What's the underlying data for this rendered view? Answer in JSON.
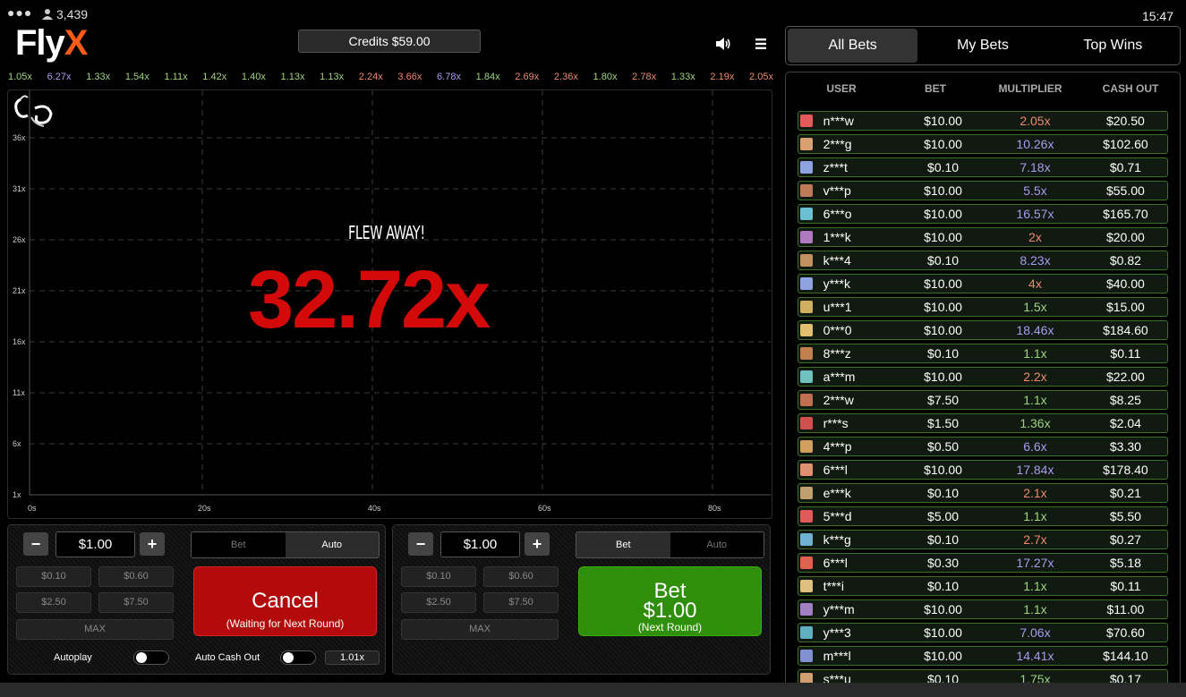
{
  "header": {
    "players_count": "3,439",
    "logo_fly": "Fly",
    "logo_x": "X",
    "credits": "Credits $59.00",
    "time": "15:47"
  },
  "history": [
    {
      "v": "1.05x",
      "c": "#9fd47f"
    },
    {
      "v": "6.27x",
      "c": "#a89cf0"
    },
    {
      "v": "1.33x",
      "c": "#9fd47f"
    },
    {
      "v": "1.54x",
      "c": "#9fd47f"
    },
    {
      "v": "1.11x",
      "c": "#9fd47f"
    },
    {
      "v": "1.42x",
      "c": "#9fd47f"
    },
    {
      "v": "1.40x",
      "c": "#9fd47f"
    },
    {
      "v": "1.13x",
      "c": "#9fd47f"
    },
    {
      "v": "1.13x",
      "c": "#9fd47f"
    },
    {
      "v": "2.24x",
      "c": "#f08a6a"
    },
    {
      "v": "3.66x",
      "c": "#f08a6a"
    },
    {
      "v": "6.78x",
      "c": "#a89cf0"
    },
    {
      "v": "1.84x",
      "c": "#9fd47f"
    },
    {
      "v": "2.69x",
      "c": "#f08a6a"
    },
    {
      "v": "2.36x",
      "c": "#f08a6a"
    },
    {
      "v": "1.80x",
      "c": "#9fd47f"
    },
    {
      "v": "2.78x",
      "c": "#f08a6a"
    },
    {
      "v": "1.33x",
      "c": "#9fd47f"
    },
    {
      "v": "2.19x",
      "c": "#f08a6a"
    },
    {
      "v": "2.05x",
      "c": "#f08a6a"
    }
  ],
  "game": {
    "status": "FLEW AWAY!",
    "crash_multiplier": "32.72x",
    "y_ticks": [
      "36x",
      "31x",
      "26x",
      "21x",
      "16x",
      "11x",
      "6x",
      "1x"
    ],
    "x_ticks": [
      "0s",
      "20s",
      "40s",
      "60s",
      "80s"
    ]
  },
  "panel1": {
    "minus": "−",
    "plus": "+",
    "amount": "$1.00",
    "chips": [
      "$0.10",
      "$0.60",
      "$2.50",
      "$7.50"
    ],
    "max": "MAX",
    "mode_bet": "Bet",
    "mode_auto": "Auto",
    "active_mode": "Auto",
    "button_main": "Cancel",
    "button_sub": "(Waiting for Next Round)",
    "autoplay_label": "Autoplay",
    "autocashout_label": "Auto Cash Out",
    "autocashout_value": "1.01x"
  },
  "panel2": {
    "minus": "−",
    "plus": "+",
    "amount": "$1.00",
    "chips": [
      "$0.10",
      "$0.60",
      "$2.50",
      "$7.50"
    ],
    "max": "MAX",
    "mode_bet": "Bet",
    "mode_auto": "Auto",
    "active_mode": "Bet",
    "button_main": "Bet",
    "button_amount": "$1.00",
    "button_sub": "(Next Round)"
  },
  "tabs": [
    "All Bets",
    "My Bets",
    "Top Wins"
  ],
  "bets": {
    "columns": [
      "USER",
      "BET",
      "MULTIPLIER",
      "CASH OUT"
    ],
    "rows": [
      {
        "user": "n***w",
        "bet": "$10.00",
        "mult": "2.05x",
        "out": "$20.50",
        "mc": "#f08a6a",
        "av": "#e35a5a"
      },
      {
        "user": "2***g",
        "bet": "$10.00",
        "mult": "10.26x",
        "out": "$102.60",
        "mc": "#a89cf0",
        "av": "#d9a070"
      },
      {
        "user": "z***t",
        "bet": "$0.10",
        "mult": "7.18x",
        "out": "$0.71",
        "mc": "#a89cf0",
        "av": "#8fa3e0"
      },
      {
        "user": "v***p",
        "bet": "$10.00",
        "mult": "5.5x",
        "out": "$55.00",
        "mc": "#a89cf0",
        "av": "#c07a5a"
      },
      {
        "user": "6***o",
        "bet": "$10.00",
        "mult": "16.57x",
        "out": "$165.70",
        "mc": "#a89cf0",
        "av": "#6ac0d0"
      },
      {
        "user": "1***k",
        "bet": "$10.00",
        "mult": "2x",
        "out": "$20.00",
        "mc": "#f08a6a",
        "av": "#b07ac0"
      },
      {
        "user": "k***4",
        "bet": "$0.10",
        "mult": "8.23x",
        "out": "$0.82",
        "mc": "#a89cf0",
        "av": "#c09060"
      },
      {
        "user": "y***k",
        "bet": "$10.00",
        "mult": "4x",
        "out": "$40.00",
        "mc": "#f08a6a",
        "av": "#8fa3e0"
      },
      {
        "user": "u***1",
        "bet": "$10.00",
        "mult": "1.5x",
        "out": "$15.00",
        "mc": "#9fd47f",
        "av": "#d0b060"
      },
      {
        "user": "0***0",
        "bet": "$10.00",
        "mult": "18.46x",
        "out": "$184.60",
        "mc": "#a89cf0",
        "av": "#e0c070"
      },
      {
        "user": "8***z",
        "bet": "$0.10",
        "mult": "1.1x",
        "out": "$0.11",
        "mc": "#9fd47f",
        "av": "#c08050"
      },
      {
        "user": "a***m",
        "bet": "$10.00",
        "mult": "2.2x",
        "out": "$22.00",
        "mc": "#f08a6a",
        "av": "#70c0c0"
      },
      {
        "user": "2***w",
        "bet": "$7.50",
        "mult": "1.1x",
        "out": "$8.25",
        "mc": "#9fd47f",
        "av": "#c07050"
      },
      {
        "user": "r***s",
        "bet": "$1.50",
        "mult": "1.36x",
        "out": "$2.04",
        "mc": "#9fd47f",
        "av": "#d05050"
      },
      {
        "user": "4***p",
        "bet": "$0.50",
        "mult": "6.6x",
        "out": "$3.30",
        "mc": "#a89cf0",
        "av": "#d0a060"
      },
      {
        "user": "6***l",
        "bet": "$10.00",
        "mult": "17.84x",
        "out": "$178.40",
        "mc": "#a89cf0",
        "av": "#e09070"
      },
      {
        "user": "e***k",
        "bet": "$0.10",
        "mult": "2.1x",
        "out": "$0.21",
        "mc": "#f08a6a",
        "av": "#c0a070"
      },
      {
        "user": "5***d",
        "bet": "$5.00",
        "mult": "1.1x",
        "out": "$5.50",
        "mc": "#9fd47f",
        "av": "#e05a5a"
      },
      {
        "user": "k***g",
        "bet": "$0.10",
        "mult": "2.7x",
        "out": "$0.27",
        "mc": "#f08a6a",
        "av": "#70b0d0"
      },
      {
        "user": "6***l",
        "bet": "$0.30",
        "mult": "17.27x",
        "out": "$5.18",
        "mc": "#a89cf0",
        "av": "#e06050"
      },
      {
        "user": "t***i",
        "bet": "$0.10",
        "mult": "1.1x",
        "out": "$0.11",
        "mc": "#9fd47f",
        "av": "#e0c080"
      },
      {
        "user": "y***m",
        "bet": "$10.00",
        "mult": "1.1x",
        "out": "$11.00",
        "mc": "#9fd47f",
        "av": "#a080c0"
      },
      {
        "user": "y***3",
        "bet": "$10.00",
        "mult": "7.06x",
        "out": "$70.60",
        "mc": "#a89cf0",
        "av": "#60b0c0"
      },
      {
        "user": "m***l",
        "bet": "$10.00",
        "mult": "14.41x",
        "out": "$144.10",
        "mc": "#a89cf0",
        "av": "#8090d0"
      },
      {
        "user": "s***u",
        "bet": "$0.10",
        "mult": "1.75x",
        "out": "$0.17",
        "mc": "#9fd47f",
        "av": "#d0a070"
      }
    ]
  }
}
